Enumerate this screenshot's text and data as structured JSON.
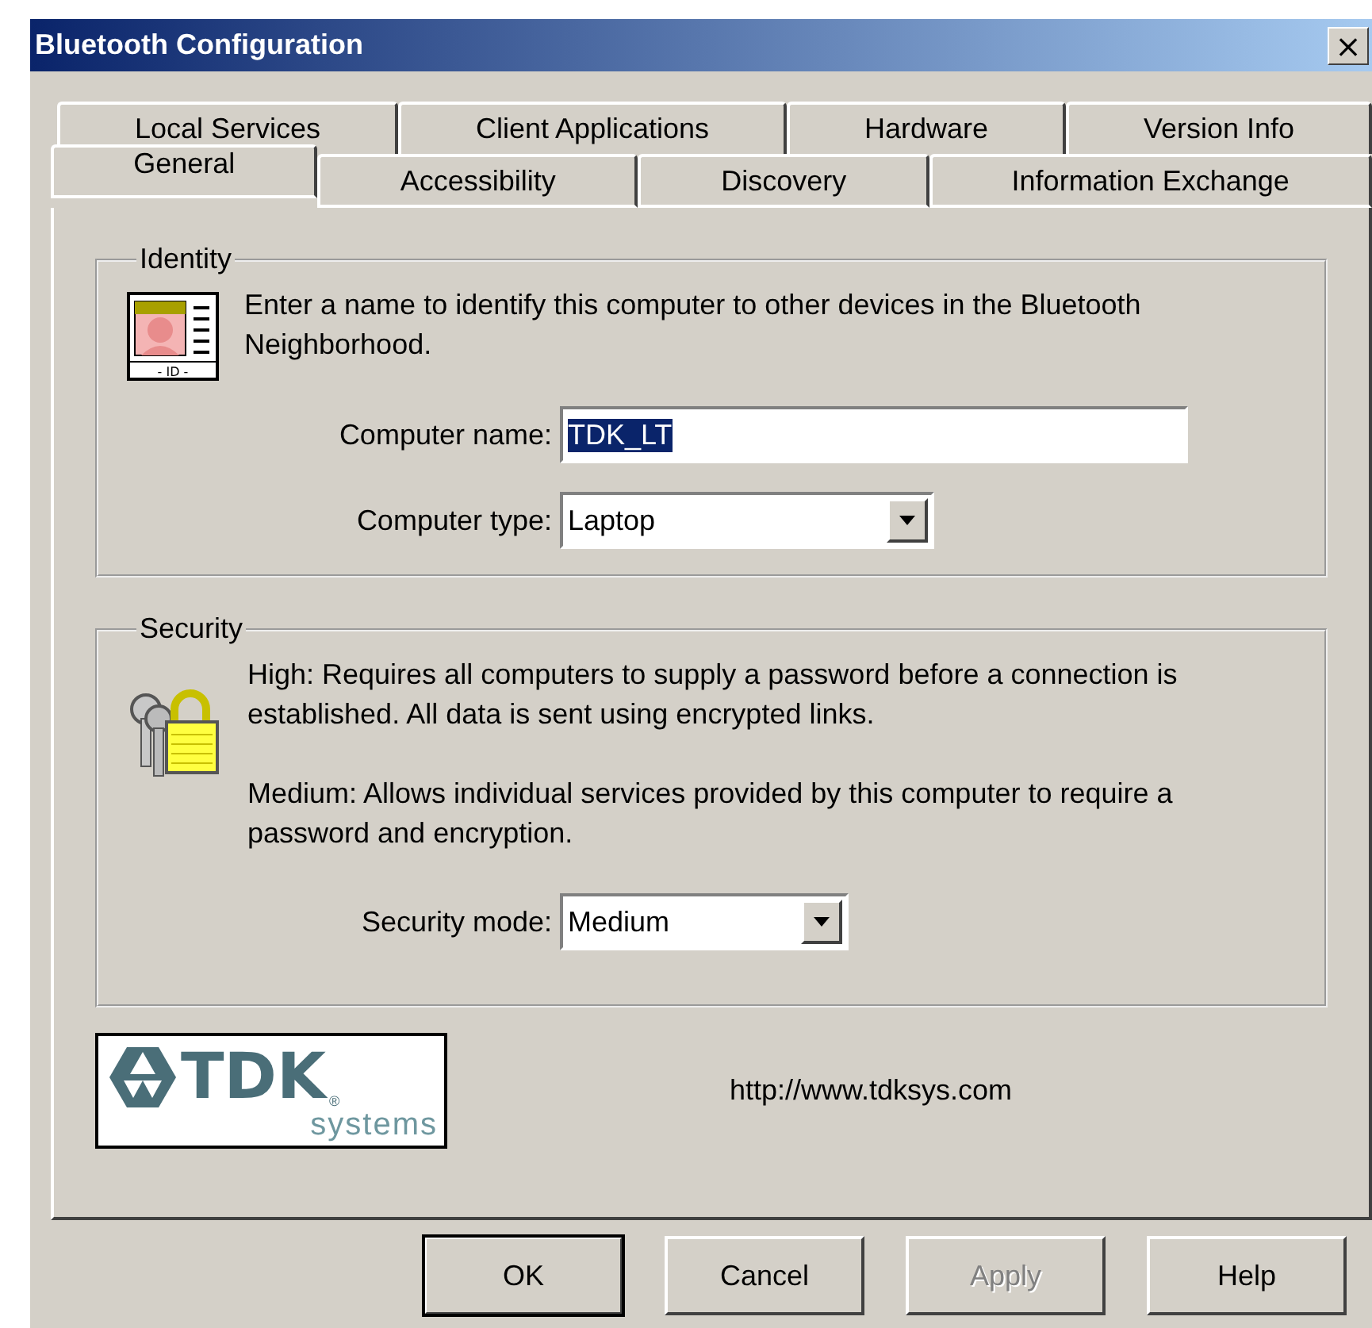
{
  "window": {
    "title": "Bluetooth Configuration",
    "close": "×"
  },
  "tab_rows": [
    [
      {
        "label": "Local Services",
        "selected": false
      },
      {
        "label": "Client Applications",
        "selected": false
      },
      {
        "label": "Hardware",
        "selected": false
      },
      {
        "label": "Version Info",
        "selected": false
      }
    ],
    [
      {
        "label": "General",
        "selected": true
      },
      {
        "label": "Accessibility",
        "selected": false
      },
      {
        "label": "Discovery",
        "selected": false
      },
      {
        "label": "Information Exchange",
        "selected": false
      }
    ]
  ],
  "identity": {
    "title": "Identity",
    "description": "Enter a name to identify this computer to other devices in the Bluetooth Neighborhood.",
    "id_badge": "- ID -",
    "fields": [
      {
        "kind": "text",
        "label": "Computer name:",
        "value": "TDK_LT",
        "text_selected": true
      },
      {
        "kind": "dropdown",
        "label": "Computer type:",
        "value": "Laptop"
      }
    ]
  },
  "security": {
    "title": "Security",
    "paragraphs": [
      "High: Requires all computers to supply a password before a connection is established.  All data is sent using encrypted links.",
      "Medium: Allows individual services provided by this computer to require a password and encryption."
    ],
    "fields": [
      {
        "kind": "dropdown",
        "label": "Security mode:",
        "value": "Medium"
      }
    ]
  },
  "logo": {
    "brand": "TDK",
    "registered": "®",
    "sub": "systems"
  },
  "url": "http://www.tdksys.com",
  "buttons": [
    {
      "label": "OK",
      "default": true,
      "disabled": false
    },
    {
      "label": "Cancel",
      "default": false,
      "disabled": false
    },
    {
      "label": "Apply",
      "default": false,
      "disabled": true
    },
    {
      "label": "Help",
      "default": false,
      "disabled": false
    }
  ]
}
